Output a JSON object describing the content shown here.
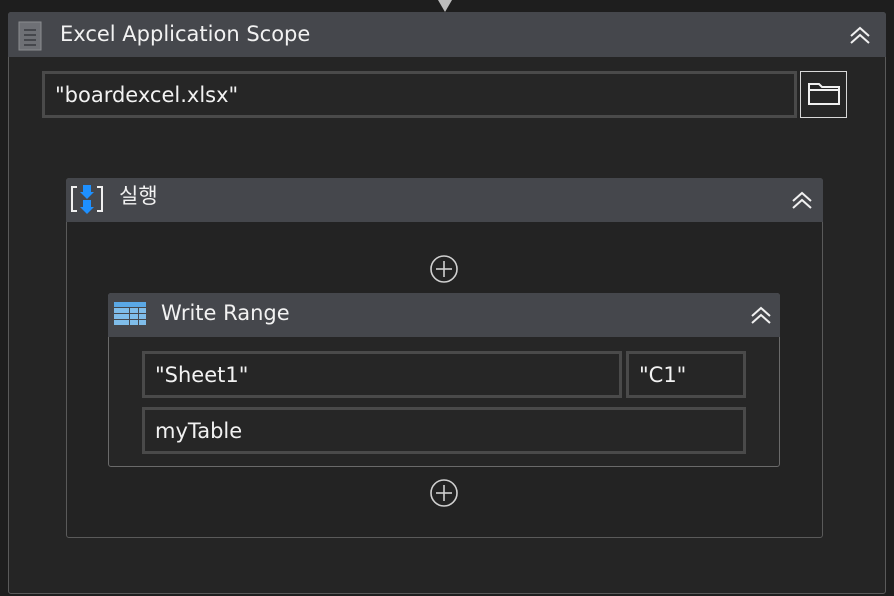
{
  "excel_scope": {
    "title": "Excel Application Scope",
    "workbook_path": "\"boardexcel.xlsx\""
  },
  "sequence": {
    "title": "실행"
  },
  "write_range": {
    "title": "Write Range",
    "sheet_name": "\"Sheet1\"",
    "start_cell": "\"C1\"",
    "data_table": "myTable"
  },
  "icons": {
    "scope": "excel-scope-icon",
    "collapse": "double-chevron-up-icon",
    "browse": "folder-icon",
    "sequence": "sequence-icon",
    "write_range": "write-range-icon",
    "add": "add-activity-icon"
  },
  "colors": {
    "background": "#1e1e1e",
    "header": "#45474c",
    "field_border": "#4a4a4a",
    "sequence_icon_blue": "#1e90ff"
  }
}
